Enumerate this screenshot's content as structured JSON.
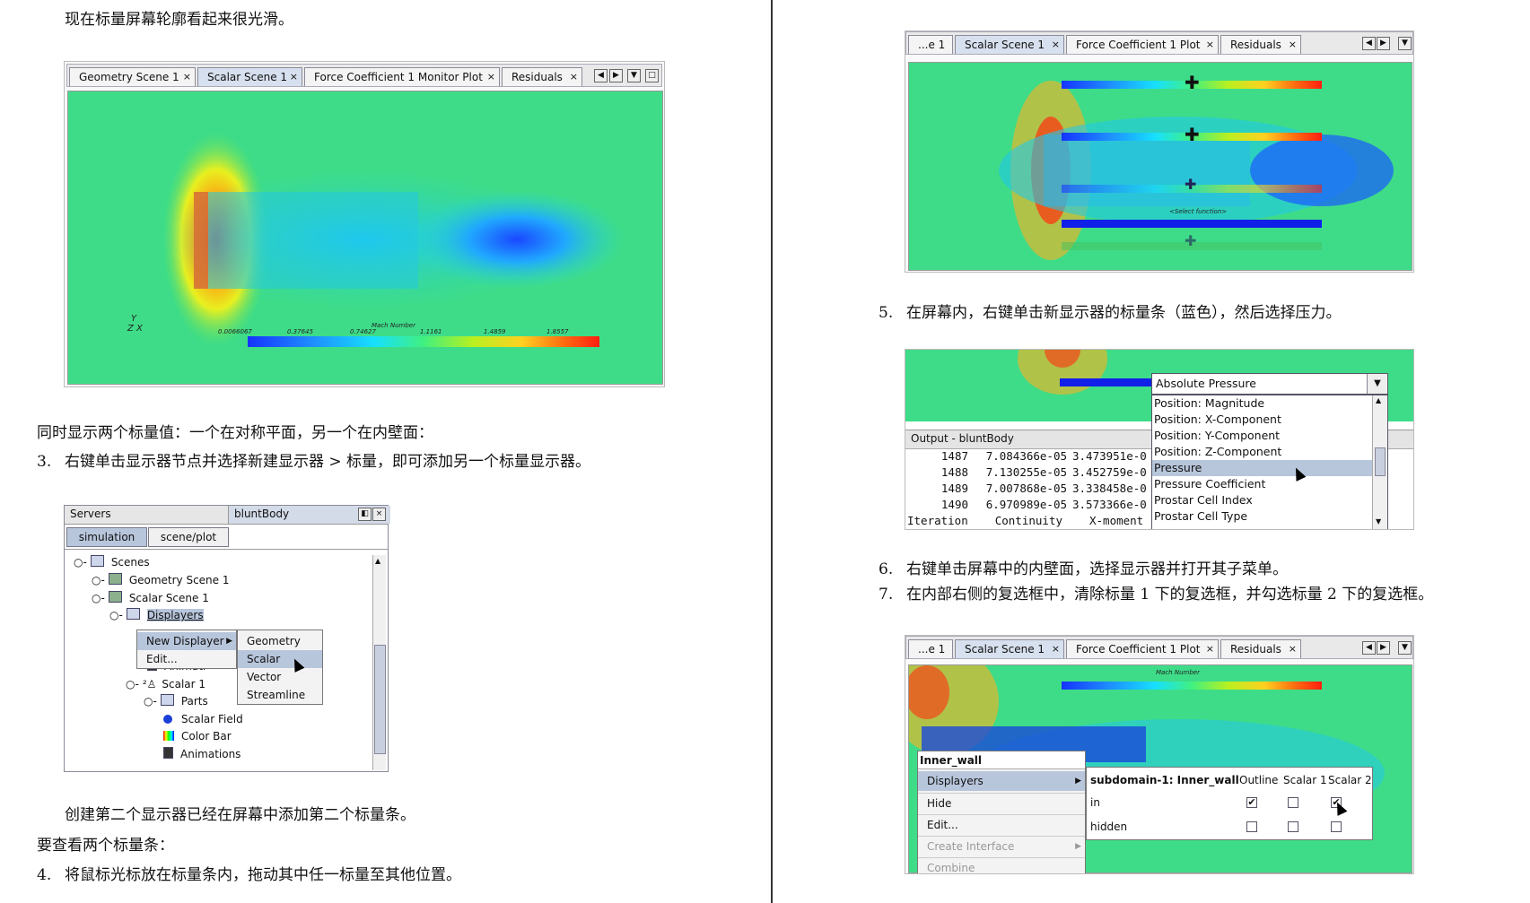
{
  "left": {
    "p_smooth": "现在标量屏幕轮廓看起来很光滑。",
    "p_two": "同时显示两个标量值：一个在对称平面，另一个在内壁面：",
    "step3_num": "3.",
    "step3": "右键单击显示器节点并选择新建显示器 > 标量，即可添加另一个标量显示器。",
    "p_created": "创建第二个显示器已经在屏幕中添加第二个标量条。",
    "p_view": "要查看两个标量条：",
    "step4_num": "4.",
    "step4": "将鼠标光标放在标量条内，拖动其中任一标量至其他位置。"
  },
  "fig1": {
    "tabs": [
      "Geometry Scene 1",
      "Scalar Scene 1",
      "Force Coefficient 1 Monitor Plot",
      "Residuals"
    ],
    "close": "×",
    "colorbar_title": "Mach Number",
    "ticks": [
      "0.0066067",
      "0.37645",
      "0.74627",
      "1.1161",
      "1.4859",
      "1.8557"
    ],
    "axis_y": "Y",
    "axis_zx": "Z X"
  },
  "fig2": {
    "servers": "Servers",
    "sim_title": "bluntBody",
    "tab_sim": "simulation",
    "tab_scene": "scene/plot",
    "tree": [
      "Scenes",
      "Geometry Scene 1",
      "Scalar Scene 1",
      "Displayers",
      "Animati",
      "Scalar 1",
      "Parts",
      "Scalar Field",
      "Color Bar",
      "Animations"
    ],
    "menu1": [
      "New Displayer",
      "Edit..."
    ],
    "menu2": [
      "Geometry",
      "Scalar",
      "Vector",
      "Streamline"
    ]
  },
  "right": {
    "step5_num": "5.",
    "step5": "在屏幕内，右键单击新显示器的标量条（蓝色），然后选择压力。",
    "step6_num": "6.",
    "step6": "右键单击屏幕中的内壁面，选择显示器并打开其子菜单。",
    "step7_num": "7.",
    "step7": "在内部右侧的复选框中，清除标量 1 下的复选框，并勾选标量 2 下的复选框。"
  },
  "fig3": {
    "tabs": [
      "...e 1",
      "Scalar Scene 1",
      "Force Coefficient 1 Plot",
      "Residuals"
    ],
    "select_label": "<Select function>"
  },
  "fig4": {
    "dropdown_value": "Absolute Pressure",
    "options": [
      "Position: Magnitude",
      "Position: X-Component",
      "Position: Y-Component",
      "Position: Z-Component",
      "Pressure",
      "Pressure Coefficient",
      "Prostar Cell Index",
      "Prostar Cell Type"
    ],
    "output_title": "Output - bluntBody",
    "rows": [
      [
        "1487",
        "7.084366e-05",
        "3.473951e-0"
      ],
      [
        "1488",
        "7.130255e-05",
        "3.452759e-0"
      ],
      [
        "1489",
        "7.007868e-05",
        "3.338458e-0"
      ],
      [
        "1490",
        "6.970989e-05",
        "3.573366e-0"
      ]
    ],
    "header": [
      "Iteration",
      "Continuity",
      "X-moment"
    ]
  },
  "fig5": {
    "tabs": [
      "...e 1",
      "Scalar Scene 1",
      "Force Coefficient 1 Plot",
      "Residuals"
    ],
    "colorbar_title": "Mach Number",
    "context_title": "Inner_wall",
    "context_items": [
      "Displayers",
      "Hide",
      "Edit...",
      "Create Interface",
      "Combine"
    ],
    "sub_title": "subdomain-1: Inner_wall",
    "cols": [
      "Outline",
      "Scalar 1",
      "Scalar 2"
    ],
    "rows": [
      "in",
      "hidden"
    ]
  }
}
